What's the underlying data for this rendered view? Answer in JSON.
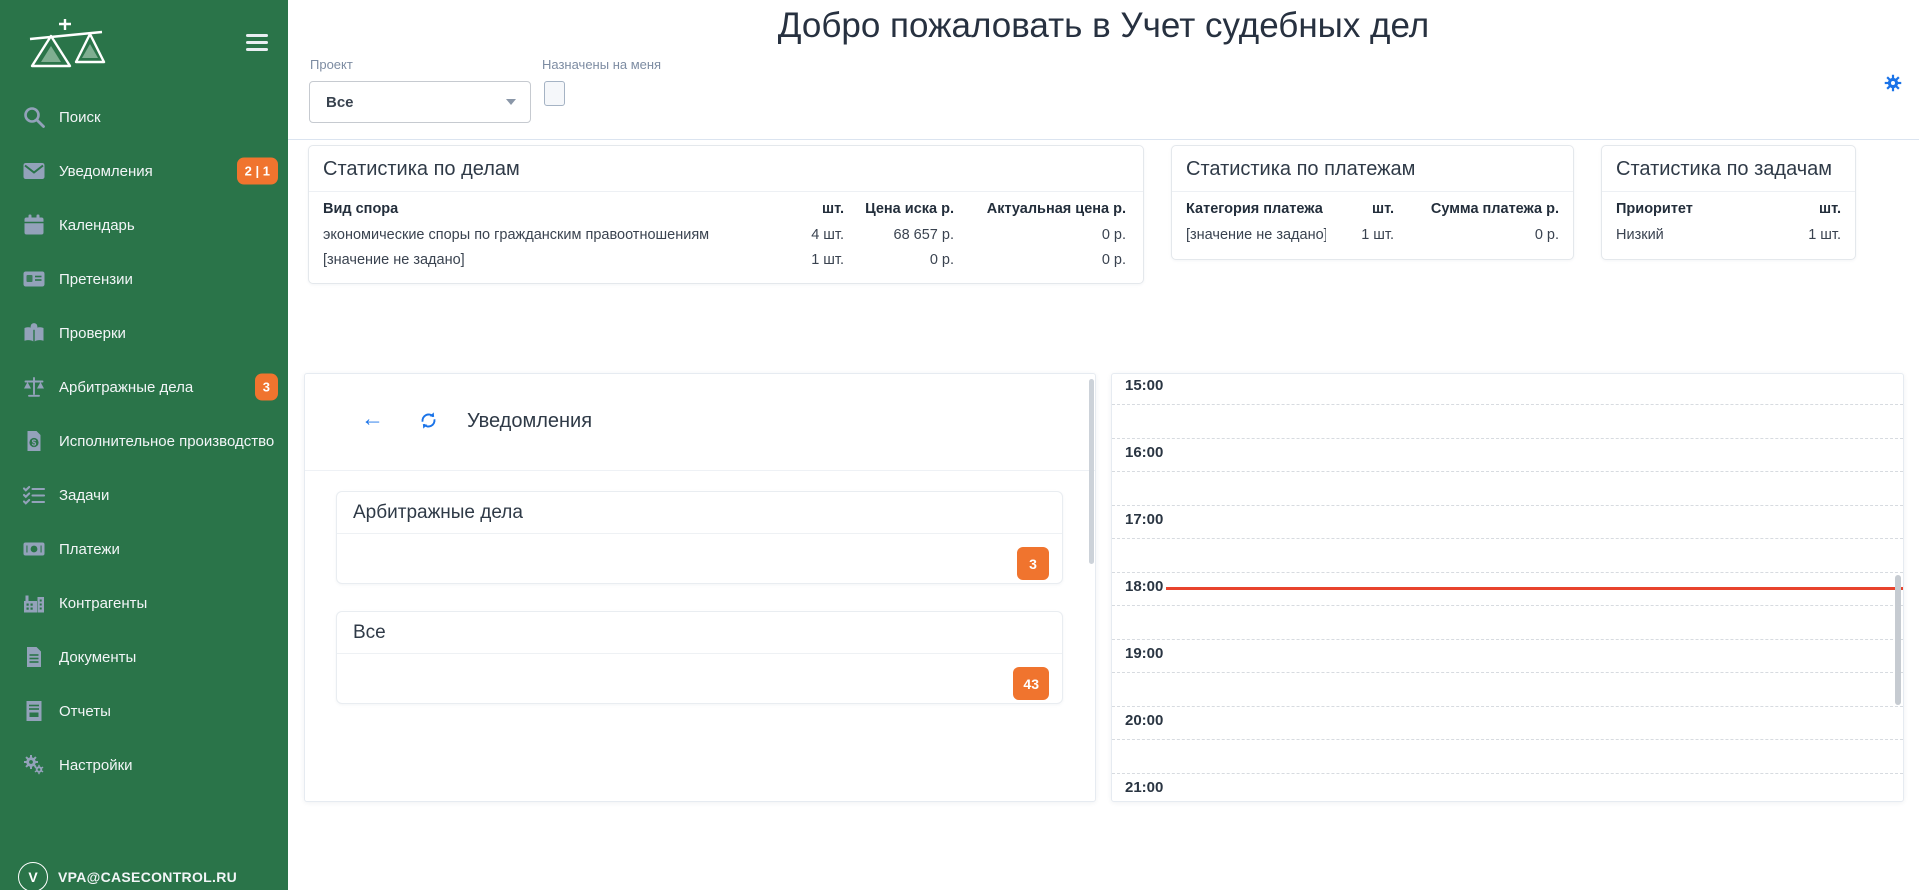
{
  "app": {
    "title": "Добро пожаловать в Учет судебных дел"
  },
  "colors": {
    "sidebar_green": "#2a7449",
    "badge_orange": "#f0742e",
    "accent_blue": "#1a73e8",
    "current_time_red": "#e8432d"
  },
  "sidebar": {
    "items": [
      {
        "label": "Поиск",
        "icon": "search-icon"
      },
      {
        "label": "Уведомления",
        "icon": "mail-icon",
        "badge": "2 | 1"
      },
      {
        "label": "Календарь",
        "icon": "calendar-icon"
      },
      {
        "label": "Претензии",
        "icon": "card-icon"
      },
      {
        "label": "Проверки",
        "icon": "book-person-icon"
      },
      {
        "label": "Арбитражные дела",
        "icon": "scales-icon",
        "badge": "3"
      },
      {
        "label": "Исполнительное производство",
        "icon": "doc-dollar-icon"
      },
      {
        "label": "Задачи",
        "icon": "checklist-icon"
      },
      {
        "label": "Платежи",
        "icon": "banknote-icon"
      },
      {
        "label": "Контрагенты",
        "icon": "building-icon"
      },
      {
        "label": "Документы",
        "icon": "document-icon"
      },
      {
        "label": "Отчеты",
        "icon": "report-icon"
      },
      {
        "label": "Настройки",
        "icon": "gears-icon"
      }
    ],
    "user": {
      "email": "VPA@CASECONTROL.RU",
      "avatar_initial": "V"
    }
  },
  "filters": {
    "project_label": "Проект",
    "project_value": "Все",
    "assigned_label": "Назначены на меня",
    "assigned_checked": false
  },
  "stats_cases": {
    "title": "Статистика по делам",
    "headers": [
      "Вид спора",
      "шт.",
      "Цена иска р.",
      "Актуальная цена р."
    ],
    "rows": [
      [
        "экономические споры по гражданским правоотношениям",
        "4 шт.",
        "68 657 р.",
        "0 р."
      ],
      [
        "[значение не задано]",
        "1 шт.",
        "0 р.",
        "0 р."
      ]
    ]
  },
  "stats_payments": {
    "title": "Статистика по платежам",
    "headers": [
      "Категория платежа",
      "шт.",
      "Сумма платежа р."
    ],
    "rows": [
      [
        "[значение не задано]",
        "1 шт.",
        "0 р."
      ]
    ]
  },
  "stats_tasks": {
    "title": "Статистика по задачам",
    "headers": [
      "Приоритет",
      "шт."
    ],
    "rows": [
      [
        "Низкий",
        "1 шт."
      ]
    ]
  },
  "notifications": {
    "title": "Уведомления",
    "groups": [
      {
        "label": "Арбитражные дела",
        "count": "3"
      },
      {
        "label": "Все",
        "count": "43"
      }
    ]
  },
  "calendar": {
    "times": [
      "15:00",
      "16:00",
      "17:00",
      "18:00",
      "19:00",
      "20:00",
      "21:00"
    ],
    "current_time_row": "18:00"
  }
}
